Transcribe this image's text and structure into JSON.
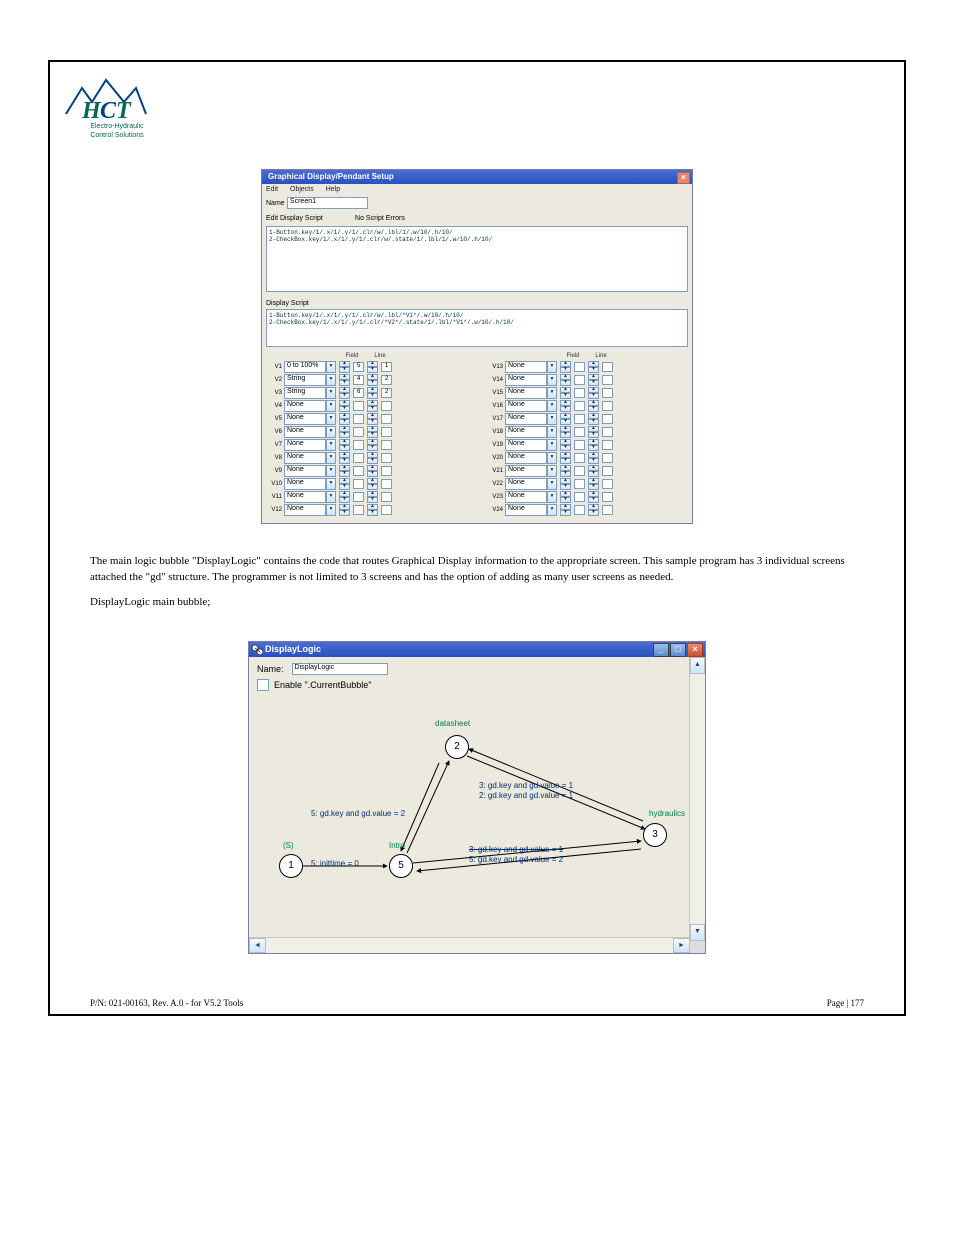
{
  "logo": {
    "line1": "Electro-Hydraulic",
    "line2": "Control Solutions"
  },
  "win1": {
    "title": "Graphical Display/Pendant Setup",
    "menu": [
      "Edit",
      "Objects",
      "Help"
    ],
    "name_label": "Name",
    "name_value": "Screen1",
    "edit_display_script_label": "Edit Display Script",
    "no_errors": "No Script Errors",
    "script1": "1-Button.key/1/.x/1/.y/1/.clr/w/.lbl/1/.w/10/.h/10/\n2-CheckBox.key/1/.x/1/.y/1/.clr/w/.state/1/.lbl/1/.w/10/.h/10/",
    "display_script_label": "Display Script",
    "script2": "1-Button.key/1/.x/1/.y/1/.clr/w/.lbl/*V1*/.w/10/.h/10/\n2-CheckBox.key/1/.x/1/.y/1/.clr/*V2*/.state/1/.lbl/*V1*/.w/10/.h/10/",
    "col_field": "Field",
    "col_line": "Line",
    "left": [
      {
        "n": "V1",
        "type": "0 to 100%",
        "field": "5",
        "line": "1"
      },
      {
        "n": "V2",
        "type": "String",
        "field": "4",
        "line": "2"
      },
      {
        "n": "V3",
        "type": "String",
        "field": "6",
        "line": "2"
      },
      {
        "n": "V4",
        "type": "None",
        "field": "",
        "line": ""
      },
      {
        "n": "V5",
        "type": "None",
        "field": "",
        "line": ""
      },
      {
        "n": "V6",
        "type": "None",
        "field": "",
        "line": ""
      },
      {
        "n": "V7",
        "type": "None",
        "field": "",
        "line": ""
      },
      {
        "n": "V8",
        "type": "None",
        "field": "",
        "line": ""
      },
      {
        "n": "V9",
        "type": "None",
        "field": "",
        "line": ""
      },
      {
        "n": "V10",
        "type": "None",
        "field": "",
        "line": ""
      },
      {
        "n": "V11",
        "type": "None",
        "field": "",
        "line": ""
      },
      {
        "n": "V12",
        "type": "None",
        "field": "",
        "line": ""
      }
    ],
    "right": [
      {
        "n": "V13",
        "type": "None",
        "field": "",
        "line": ""
      },
      {
        "n": "V14",
        "type": "None",
        "field": "",
        "line": ""
      },
      {
        "n": "V15",
        "type": "None",
        "field": "",
        "line": ""
      },
      {
        "n": "V16",
        "type": "None",
        "field": "",
        "line": ""
      },
      {
        "n": "V17",
        "type": "None",
        "field": "",
        "line": ""
      },
      {
        "n": "V18",
        "type": "None",
        "field": "",
        "line": ""
      },
      {
        "n": "V19",
        "type": "None",
        "field": "",
        "line": ""
      },
      {
        "n": "V20",
        "type": "None",
        "field": "",
        "line": ""
      },
      {
        "n": "V21",
        "type": "None",
        "field": "",
        "line": ""
      },
      {
        "n": "V22",
        "type": "None",
        "field": "",
        "line": ""
      },
      {
        "n": "V23",
        "type": "None",
        "field": "",
        "line": ""
      },
      {
        "n": "V24",
        "type": "None",
        "field": "",
        "line": ""
      }
    ]
  },
  "midtext": {
    "p1": "The main logic bubble \"DisplayLogic\" contains the code that routes Graphical Display information to the appropriate screen.  This sample program has 3 individual screens attached the \"gd\" structure.  The programmer is not limited to 3 screens and has the option of adding as many user screens as needed.",
    "p2": "DisplayLogic main bubble;"
  },
  "win2": {
    "title": "DisplayLogic",
    "name_label": "Name:",
    "name_value": "DisplayLogic",
    "enable_label": "Enable \".CurrentBubble\"",
    "labels": {
      "datasheet": "datasheet",
      "hydraulics": "hydraulics",
      "intro": "Intro",
      "s": "(S)"
    },
    "edges": {
      "e1": "5: inittime = 0",
      "e2": "5: gd.key and gd.value = 2",
      "e3": "3: gd.key and gd.value = 1",
      "e4": "2: gd.key and gd.value = 1",
      "e5": "3: gd.key and gd.value = 1",
      "e6": "5: gd.key and gd.value = 2"
    },
    "bubbles": {
      "b1": "1",
      "b2": "2",
      "b3": "3",
      "b5": "5"
    }
  },
  "footer": {
    "left": "P/N: 021-00163, Rev. A.0 - for V5.2 Tools",
    "right": "Page | 177"
  }
}
